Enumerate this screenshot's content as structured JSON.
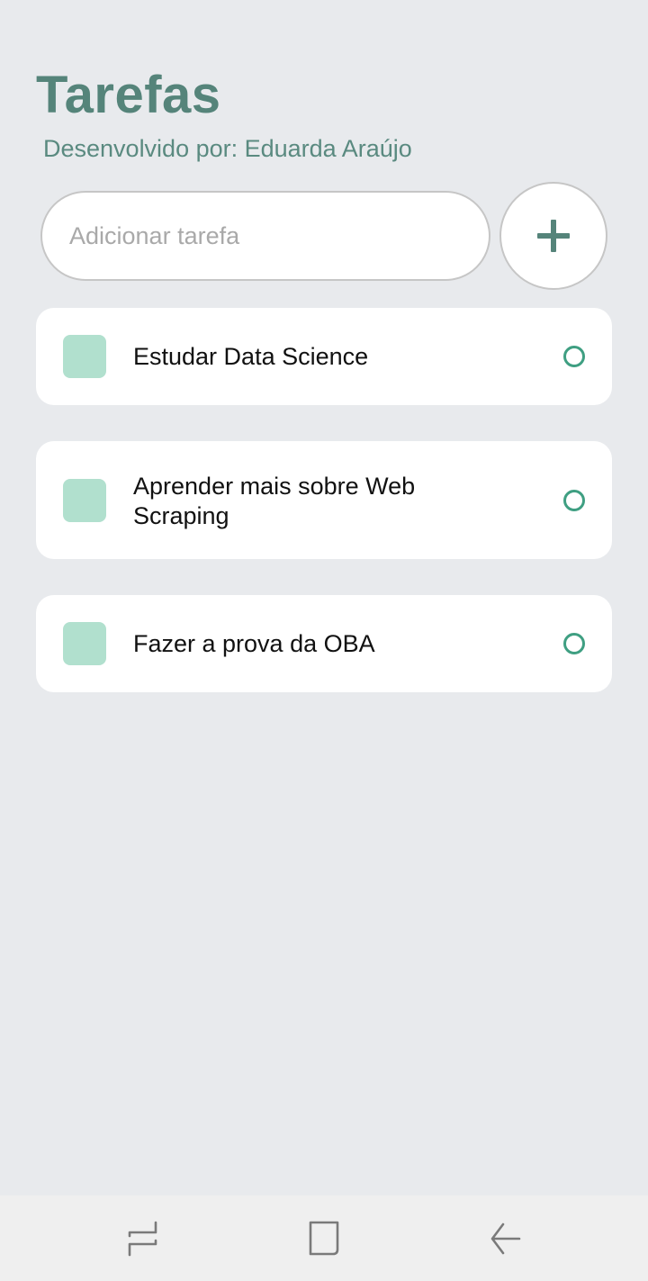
{
  "header": {
    "title": "Tarefas",
    "subtitle": "Desenvolvido por: Eduarda Araújo"
  },
  "add_task": {
    "input_value": "",
    "placeholder": "Adicionar tarefa",
    "button_icon": "plus-icon"
  },
  "tasks": [
    {
      "text": "Estudar Data Science",
      "done": false
    },
    {
      "text": "Aprender mais sobre Web Scraping",
      "done": false
    },
    {
      "text": "Fazer a prova da OBA",
      "done": false
    }
  ],
  "navbar": {
    "icons": [
      "recent-apps-icon",
      "home-icon",
      "back-icon"
    ]
  },
  "colors": {
    "background": "#e8eaed",
    "accent": "#55847a",
    "task_square": "#b1e0ce",
    "task_circle": "#3f9f82"
  }
}
